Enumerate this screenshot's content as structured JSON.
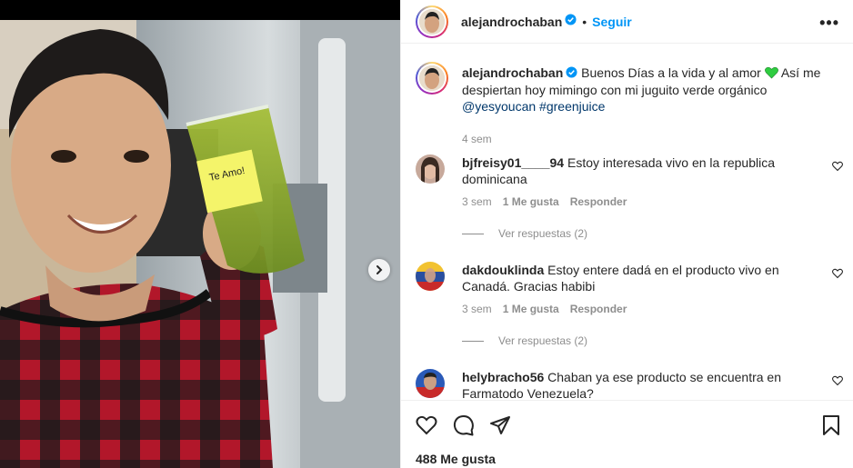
{
  "post": {
    "username": "alejandrochaban",
    "follow_label": "Seguir",
    "dot": "•",
    "more_label": "•••",
    "photo_note": "Te Amo!"
  },
  "caption": {
    "username": "alejandrochaban",
    "text_before": "Buenos Días a la vida y al amor",
    "emoji": "green-heart-icon",
    "text_after": "Así me despiertan hoy mimingo con mi juguito verde orgánico",
    "mention": "@yesyoucan",
    "hashtag": "#greenjuice",
    "time": "4 sem"
  },
  "comments": [
    {
      "username": "bjfreisy01____94",
      "text": "Estoy interesada vivo en la republica dominicana",
      "time": "3 sem",
      "likes": "1 Me gusta",
      "reply_label": "Responder",
      "view_replies": "Ver respuestas (2)"
    },
    {
      "username": "dakdouklinda",
      "text": "Estoy entere dadá en el producto vivo en Canadá. Gracias habibi",
      "time": "3 sem",
      "likes": "1 Me gusta",
      "reply_label": "Responder",
      "view_replies": "Ver respuestas (2)"
    },
    {
      "username": "helybracho56",
      "text": "Chaban ya ese producto se encuentra en Farmatodo Venezuela?"
    }
  ],
  "footer": {
    "likes": "488 Me gusta"
  },
  "colors": {
    "accent": "#0095f6",
    "text": "#262626",
    "muted": "#8e8e8e",
    "link": "#00376b",
    "heart": "#2ecc40"
  }
}
